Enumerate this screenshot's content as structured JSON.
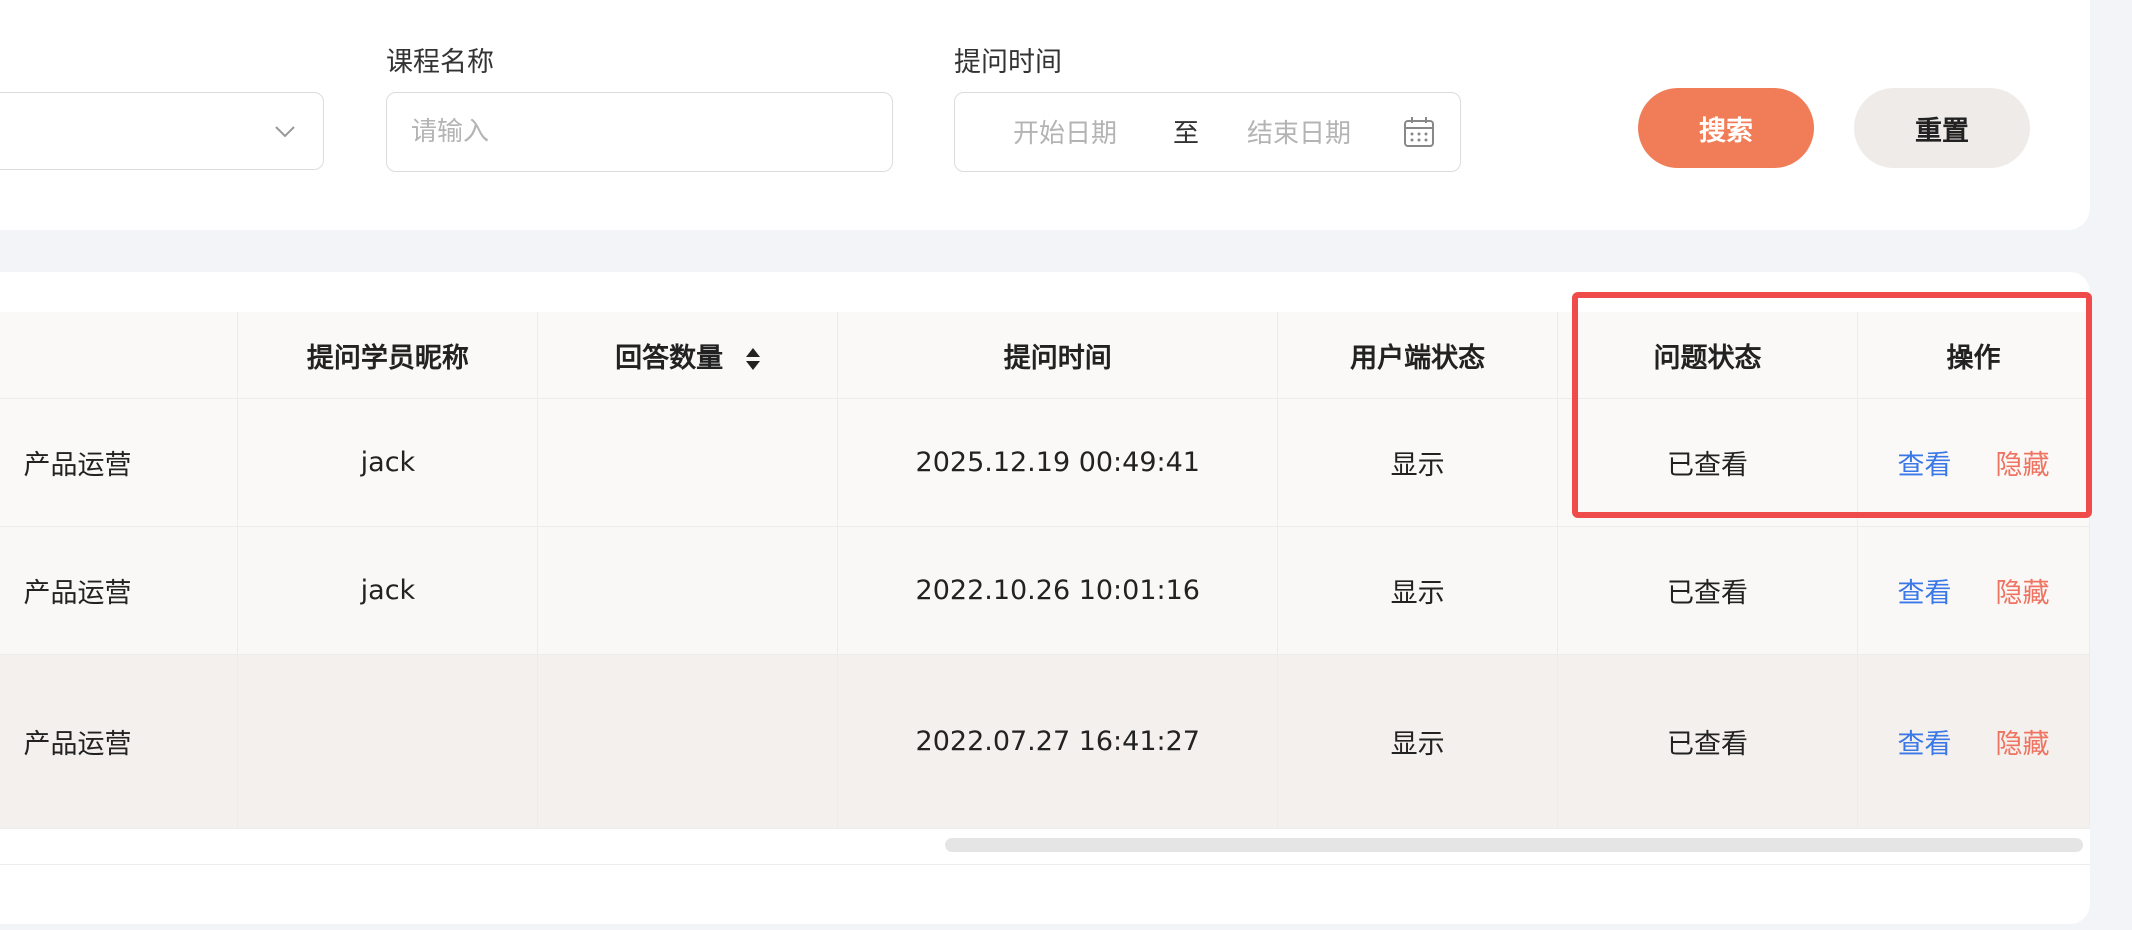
{
  "filters": {
    "course_name_label": "课程名称",
    "course_name_placeholder": "请输入",
    "ask_time_label": "提问时间",
    "start_date_placeholder": "开始日期",
    "range_separator": "至",
    "end_date_placeholder": "结束日期",
    "search_label": "搜索",
    "reset_label": "重置"
  },
  "table": {
    "headers": {
      "nickname": "提问学员昵称",
      "answer_count": "回答数量",
      "ask_time": "提问时间",
      "client_status": "用户端状态",
      "question_status": "问题状态",
      "actions": "操作"
    },
    "rows": [
      {
        "course": "产品运营",
        "nickname": "jack",
        "answer_count": "",
        "ask_time": "2025.12.19 00:49:41",
        "client_status": "显示",
        "question_status": "已查看",
        "view": "查看",
        "hide": "隐藏"
      },
      {
        "course": "产品运营",
        "nickname": "jack",
        "answer_count": "",
        "ask_time": "2022.10.26 10:01:16",
        "client_status": "显示",
        "question_status": "已查看",
        "view": "查看",
        "hide": "隐藏"
      },
      {
        "course": "产品运营",
        "nickname": "",
        "answer_count": "",
        "ask_time": "2022.07.27 16:41:27",
        "client_status": "显示",
        "question_status": "已查看",
        "view": "查看",
        "hide": "隐藏"
      }
    ]
  },
  "colors": {
    "accent": "#f07d57",
    "link_view": "#3a78e8",
    "link_hide": "#ef7361",
    "highlight": "#ef4b4b"
  }
}
